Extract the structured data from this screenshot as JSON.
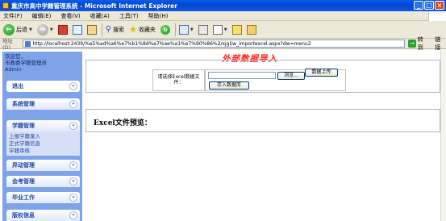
{
  "window": {
    "title": "重庆市高中学籍管理系统 - Microsoft Internet Explorer",
    "controls": [
      "_",
      "□",
      "×"
    ]
  },
  "menu": [
    "文件(F)",
    "编辑(E)",
    "查看(V)",
    "收藏(A)",
    "工具(T)",
    "帮助(H)"
  ],
  "toolbar": {
    "back": "后退",
    "search": "搜索",
    "favorites": "收藏夹"
  },
  "address": {
    "label": "地址(D)",
    "url": "http://localhost:2439/%e5%ad%a6%e7%b1%8d%e7%ae%a1%e7%90%86%2/xjgl/w_importexcel.aspx?dw=menu2",
    "go": "转到",
    "links": "链接"
  },
  "sidebar": {
    "welcome": [
      "欢迎您，",
      "市教委学籍管理员",
      "Admin"
    ],
    "exit": "退出",
    "sections": [
      "系统管理",
      "学籍管理",
      "异动管理",
      "会考管理",
      "毕业工作",
      "版权信息"
    ],
    "sub_items": [
      "上报学籍录入",
      "正式学籍信息",
      "学籍审核"
    ]
  },
  "main": {
    "headline": "外部数据导入",
    "select_label": "请选择Excel数据文件：",
    "browse": "浏览...",
    "upload": "数据上传",
    "save": "存入数据库",
    "preview_title": "Excel文件预览："
  }
}
